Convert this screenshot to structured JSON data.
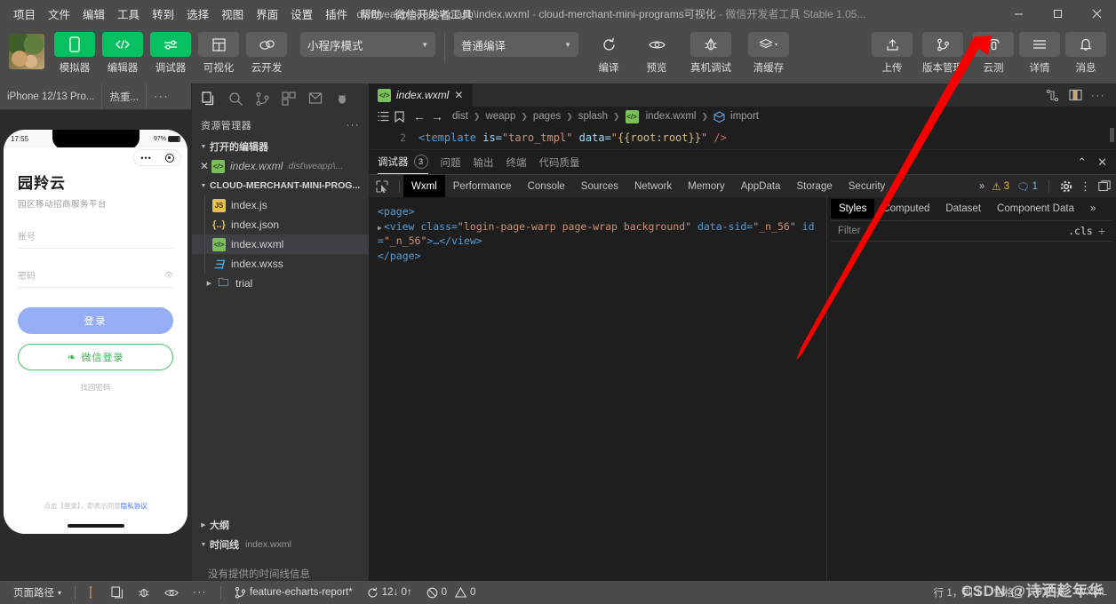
{
  "titlebar": {
    "menus": [
      "项目",
      "文件",
      "编辑",
      "工具",
      "转到",
      "选择",
      "视图",
      "界面",
      "设置",
      "插件",
      "帮助",
      "微信开发者工具"
    ],
    "path": "dist\\weapp\\pages\\splash\\index.wxml",
    "sep1": "-",
    "project": "cloud-merchant-mini-programs可视化",
    "sep2": "-",
    "app": "微信开发者工具 Stable 1.05...",
    "minimize": "—",
    "maximize": "▢",
    "close": "✕"
  },
  "toolbar": {
    "items": [
      {
        "label": "模拟器",
        "icon": "phone-icon",
        "style": "green"
      },
      {
        "label": "编辑器",
        "icon": "code-icon",
        "style": "green"
      },
      {
        "label": "调试器",
        "icon": "sliders-icon",
        "style": "green"
      },
      {
        "label": "可视化",
        "icon": "layout-icon",
        "style": "grey"
      },
      {
        "label": "云开发",
        "icon": "cloud-icon",
        "style": "grey"
      }
    ],
    "mode_select": "小程序模式",
    "compile_select": "普通编译",
    "actions": [
      {
        "label": "编译",
        "icon": "refresh-icon"
      },
      {
        "label": "预览",
        "icon": "eye-icon"
      },
      {
        "label": "真机调试",
        "icon": "bug-icon"
      },
      {
        "label": "清缓存",
        "icon": "layers-icon"
      }
    ],
    "right_items": [
      {
        "label": "上传",
        "icon": "upload-icon"
      },
      {
        "label": "版本管理",
        "icon": "branch-icon"
      },
      {
        "label": "云测",
        "icon": "cloud-test-icon"
      },
      {
        "label": "详情",
        "icon": "menu-icon"
      },
      {
        "label": "消息",
        "icon": "bell-icon"
      }
    ]
  },
  "simulator": {
    "device": "iPhone 12/13 Pro...",
    "refresh": "热重...",
    "more": "···",
    "status_time": "17:55",
    "battery": "97%",
    "app": {
      "title": "园羚云",
      "subtitle": "园区移动招商服务平台",
      "account_placeholder": "账号",
      "password_placeholder": "密码",
      "login_button": "登录",
      "wechat_button": "微信登录",
      "wechat_icon": "wechat-icon",
      "forgot": "找回密码",
      "agreement_prefix": "点击【登录】，即表示同意",
      "agreement_link": "隐私协议"
    }
  },
  "explorer": {
    "activity_icons": [
      "files-icon",
      "search-icon",
      "source-control-icon",
      "extensions-icon",
      "debug-icon",
      "bug-insect-icon"
    ],
    "header": "资源管理器",
    "header_more": "···",
    "open_editors_title": "打开的编辑器",
    "open_editor": {
      "close": "✕",
      "name": "index.wxml",
      "path": "dist\\weapp\\..."
    },
    "project_title": "CLOUD-MERCHANT-MINI-PROG...",
    "files": [
      {
        "name": "index.js",
        "type": "js"
      },
      {
        "name": "index.json",
        "type": "json"
      },
      {
        "name": "index.wxml",
        "type": "wxml",
        "selected": true
      },
      {
        "name": "index.wxss",
        "type": "wxss"
      }
    ],
    "folder": {
      "name": "trial",
      "type": "folder"
    },
    "outline_title": "大纲",
    "timeline_title": "时间线",
    "timeline_file": "index.wxml",
    "timeline_empty": "没有提供的时间线信息"
  },
  "editor": {
    "tab": {
      "name": "index.wxml",
      "close": "✕",
      "icon": "wxml-file-icon"
    },
    "tab_actions": [
      "split-compare-icon",
      "split-editor-icon",
      "more-icon"
    ],
    "breadcrumb_icons": [
      "outline-icon",
      "bookmark-icon",
      "back-arrow-icon",
      "forward-arrow-icon"
    ],
    "breadcrumb": [
      "dist",
      "weapp",
      "pages",
      "splash",
      "index.wxml",
      "import"
    ],
    "line_number": "2",
    "code": {
      "tag_open": "<template",
      "attr1": "is=",
      "val1": "\"taro_tmpl\"",
      "attr2": "data=",
      "val2a": "\"",
      "val2b": "{{root:root}}",
      "val2c": "\"",
      "tag_close": "/>"
    }
  },
  "debugger": {
    "tabs": [
      {
        "label": "调试器",
        "badge": "3",
        "active": true
      },
      {
        "label": "问题",
        "active": false
      },
      {
        "label": "输出",
        "active": false
      },
      {
        "label": "终端",
        "active": false
      },
      {
        "label": "代码质量",
        "active": false
      }
    ],
    "panel_collapse": "⌃",
    "panel_close": "✕",
    "devtools_tabs": [
      "Wxml",
      "Performance",
      "Console",
      "Sources",
      "Network",
      "Memory",
      "AppData",
      "Storage",
      "Security"
    ],
    "devtools_active": "Wxml",
    "overflow": "»",
    "warn_count": "3",
    "info_count": "1",
    "inspect_icon": "inspect-element-icon",
    "settings_icon": "gear-icon",
    "kebab_icon": "more-vertical-icon",
    "dock_icon": "dock-icon",
    "wxml": {
      "line1": "<page>",
      "line2a": "<view class=",
      "line2b": "\"login-page-warp page-wrap background\"",
      "line2c": " data-sid=",
      "line2d": "\"_n_56\"",
      "line2e": " id=",
      "line2f": "\"_n_56\"",
      "line2g": ">…</view>",
      "line3": "</page>"
    },
    "styles": {
      "tabs": [
        "Styles",
        "Computed",
        "Dataset",
        "Component Data"
      ],
      "active": "Styles",
      "overflow": "»",
      "filter_placeholder": "Filter",
      "cls": ".cls",
      "plus": "+"
    }
  },
  "statusbar": {
    "page_path": "页面路径",
    "page_path_caret": "▾",
    "icons": [
      "cursor-icon",
      "copy-icon",
      "bug-icon",
      "eye-icon",
      "more-icon"
    ],
    "branch_icon": "branch-icon",
    "branch": "feature-echarts-report*",
    "sync_icon": "sync-icon",
    "sync": "12↓ 0↑",
    "errors_icon": "error-circle-icon",
    "errors": "0",
    "warnings_icon": "warning-triangle-icon",
    "warnings": "0",
    "cursor": "行 1，列 1",
    "selection": "空格:2",
    "encoding": "UTF-8",
    "language": "WXML"
  },
  "watermark": "CSDN @诗洒趁年华",
  "colors": {
    "accent_green": "#07c160",
    "titlebar": "#4b4b4b",
    "editor_bg": "#1e1e1e",
    "annotation_red": "#f80000"
  }
}
